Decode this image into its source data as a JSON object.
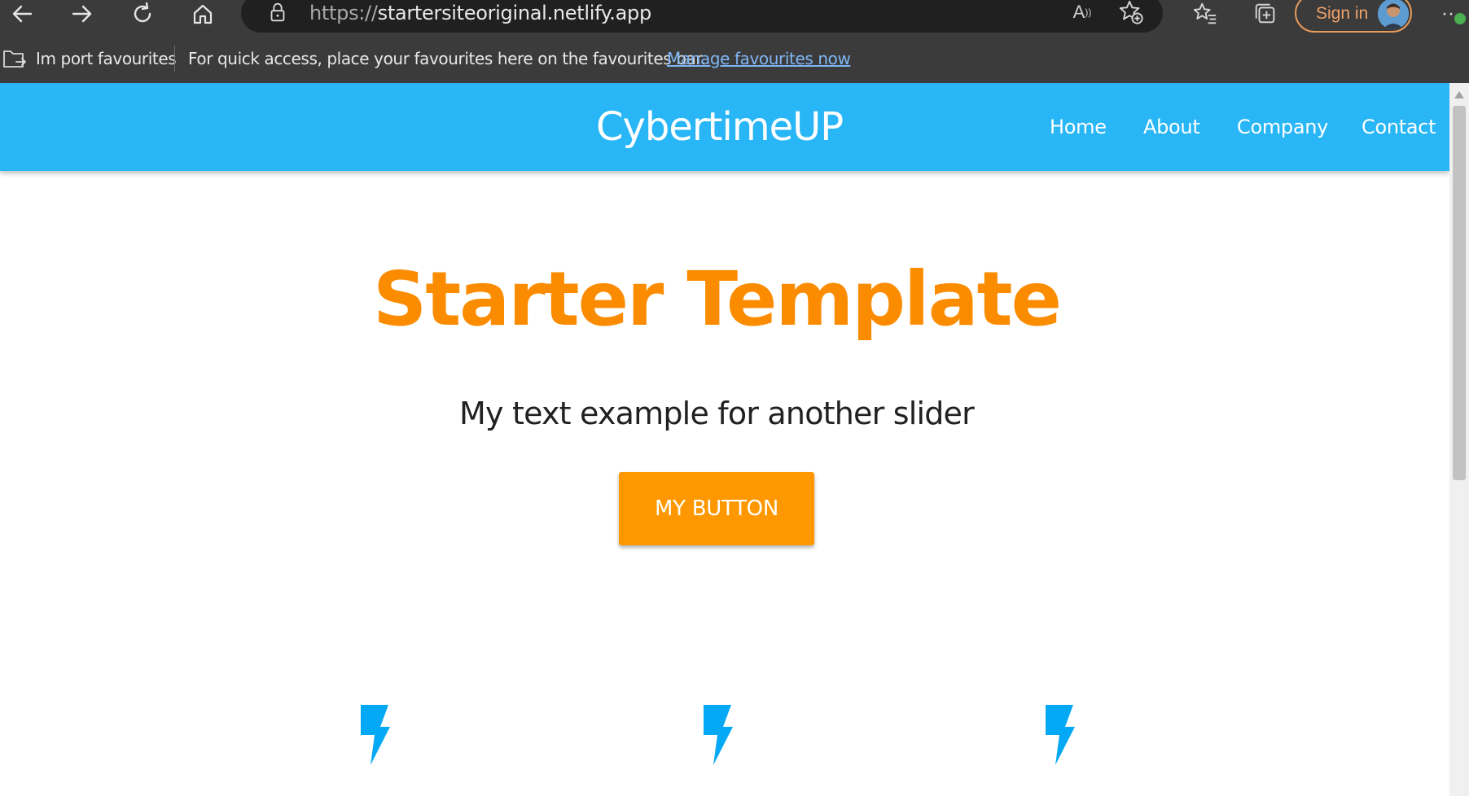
{
  "browser": {
    "url_scheme": "https://",
    "url_host": "startersiteoriginal.netlify.app",
    "read_aloud_label": "A",
    "sign_in_label": "Sign in",
    "more_label": "···"
  },
  "favourites_bar": {
    "import_label": "Im port favourites",
    "message": "For quick access, place your favourites here on the favourites bar.",
    "manage_link": "Manage favourites now"
  },
  "site": {
    "brand": "CybertimeUP",
    "nav": [
      "Home",
      "About",
      "Company",
      "Contact"
    ],
    "hero": {
      "title": "Starter Template",
      "subtitle": "My text example for another slider",
      "button_label": "MY BUTTON"
    },
    "feature_icons": [
      "flash-icon",
      "flash-icon",
      "flash-icon"
    ]
  },
  "colors": {
    "nav_bg": "#29b6f6",
    "title": "#fb8c00",
    "button_bg": "#ff9800",
    "icon": "#03a9f4",
    "chrome_bg": "#3b3b3b",
    "link": "#7fb6f5"
  }
}
